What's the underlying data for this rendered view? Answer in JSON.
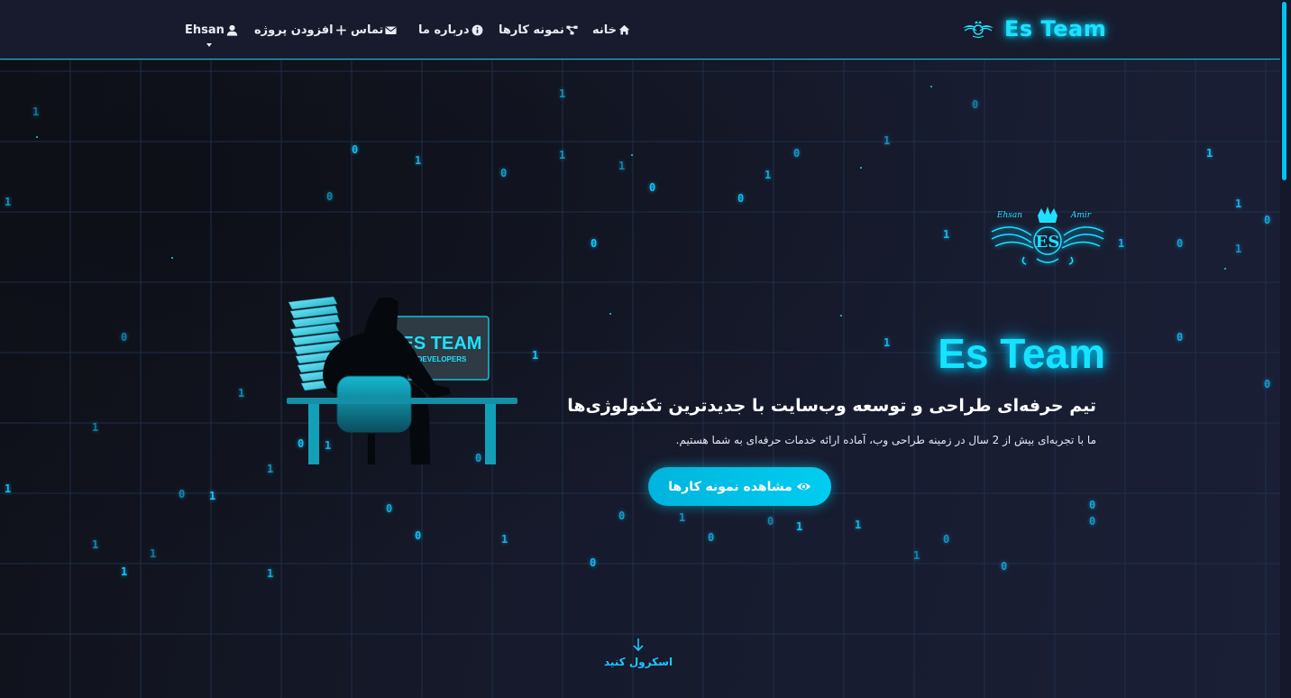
{
  "navbar": {
    "brand": "Es Team",
    "items": [
      {
        "label": "خانه",
        "icon": "home-icon"
      },
      {
        "label": "نمونه کارها",
        "icon": "project-diagram-icon"
      },
      {
        "label": "درباره ما",
        "icon": "info-circle-icon"
      },
      {
        "label": "تماس",
        "icon": "envelope-icon"
      },
      {
        "label": "افزودن پروژه",
        "icon": "plus-icon"
      },
      {
        "label": "Ehsan",
        "icon": "user-icon"
      }
    ]
  },
  "hero": {
    "logo_text": {
      "left_name": "Ehsan",
      "right_name": "Amir",
      "monogram": "ES"
    },
    "illustration": {
      "screen_title": "ES TEAM",
      "screen_subtitle": "DEVELOPERS"
    },
    "title": "Es Team",
    "subtitle": "تیم حرفه‌ای طراحی و توسعه وب‌سایت با جدیدترین تکنولوژی‌ها",
    "description": "ما با تجربه‌ای بیش از 2 سال در زمینه طراحی وب، آماده ارائه خدمات حرفه‌ای به شما هستیم.",
    "cta_label": "مشاهده نمونه کارها",
    "scroll_label": "اسکرول کنید"
  },
  "colors": {
    "accent": "#00cdf0",
    "background": "#161a2c",
    "navbar": "#171b2d",
    "glow": "#16e3ff"
  },
  "binary_rain": [
    "1",
    "0",
    "1",
    "0",
    "1",
    "1",
    "0",
    "0",
    "1",
    "0",
    "1",
    "0",
    "1",
    "1",
    "0",
    "1",
    "0",
    "0",
    "1",
    "1",
    "0",
    "1",
    "0",
    "1",
    "1",
    "0",
    "0",
    "1",
    "1",
    "0",
    "1",
    "0",
    "1",
    "0",
    "1",
    "1",
    "0",
    "0",
    "1",
    "0",
    "1",
    "1",
    "0",
    "0",
    "1",
    "1",
    "0",
    "1",
    "0",
    "0",
    "1",
    "1",
    "0",
    "1",
    "0",
    "1"
  ]
}
